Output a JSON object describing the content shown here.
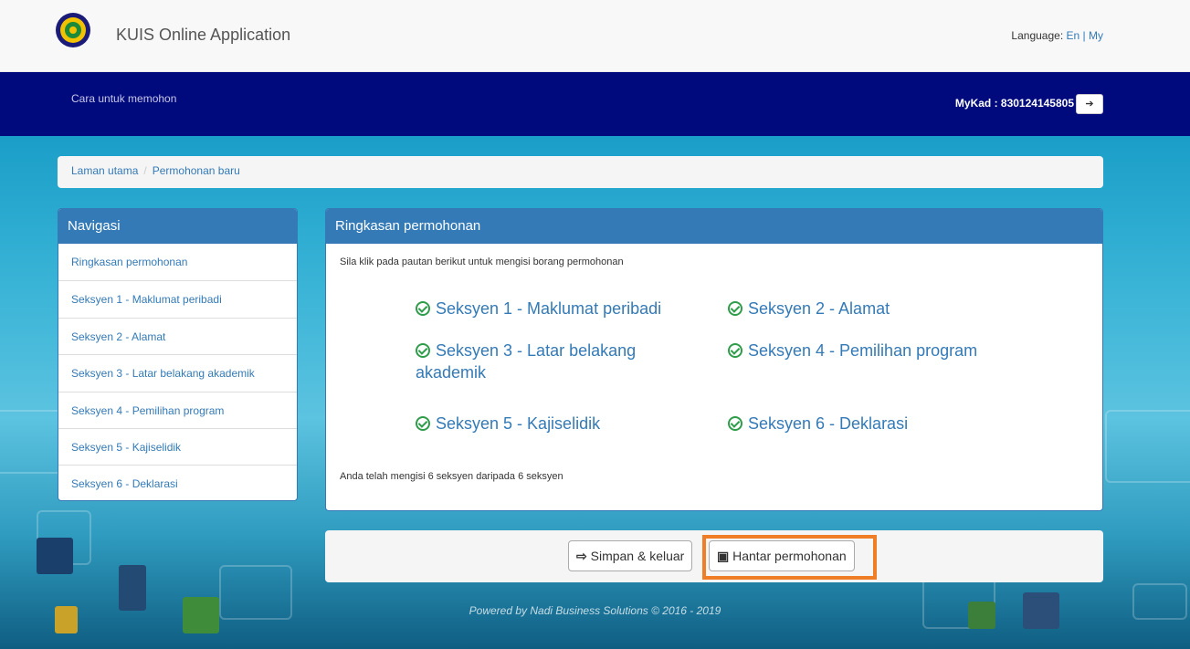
{
  "header": {
    "app_title": "KUIS Online Application",
    "language_label": "Language:",
    "lang_en": "En",
    "lang_sep": "|",
    "lang_my": "My"
  },
  "navbar": {
    "link": "Cara untuk memohon",
    "mykad": "MyKad : 830124145805"
  },
  "breadcrumb": {
    "home": "Laman utama",
    "separator": "/",
    "current": "Permohonan baru"
  },
  "navigation": {
    "title": "Navigasi",
    "items": [
      "Ringkasan permohonan",
      "Seksyen 1 - Maklumat peribadi",
      "Seksyen 2 - Alamat",
      "Seksyen 3 - Latar belakang akademik",
      "Seksyen 4 - Pemilihan program",
      "Seksyen 5 - Kajiselidik",
      "Seksyen 6 - Deklarasi"
    ]
  },
  "summary": {
    "title": "Ringkasan permohonan",
    "instruction": "Sila klik pada pautan berikut untuk mengisi borang permohonan",
    "sections": [
      "Seksyen 1 - Maklumat peribadi",
      "Seksyen 2 - Alamat",
      "Seksyen 3 - Latar belakang akademik",
      "Seksyen 4 - Pemilihan program",
      "Seksyen 5 - Kajiselidik",
      "Seksyen 6 - Deklarasi"
    ],
    "completed": "Anda telah mengisi 6 seksyen daripada 6 seksyen"
  },
  "actions": {
    "save_exit": "Simpan & keluar",
    "submit": "Hantar permohonan"
  },
  "footer": {
    "powered": "Powered by Nadi Business Solutions © 2016 - 2019"
  },
  "colors": {
    "navbar": "#000a7d",
    "panel_header": "#337ab7",
    "link": "#337ab7",
    "check": "#2e9c4a",
    "highlight": "#f07e26"
  }
}
